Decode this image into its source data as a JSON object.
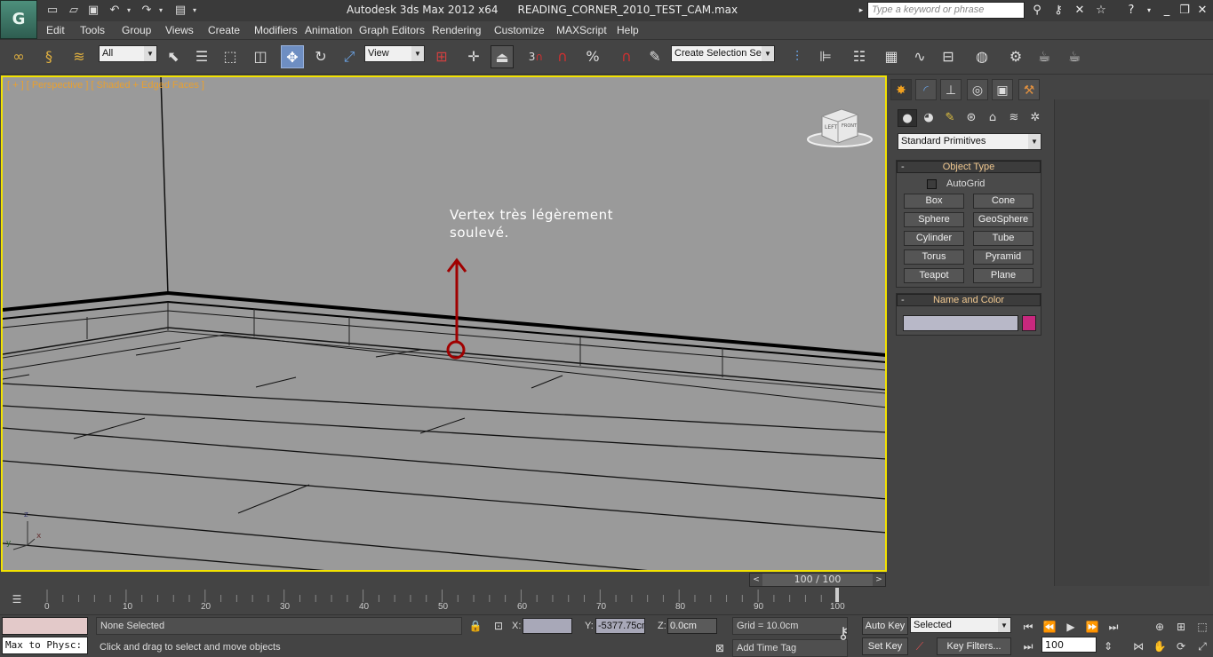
{
  "app": {
    "logo": "G",
    "title_app": "Autodesk 3ds Max  2012 x64",
    "title_file": "READING_CORNER_2010_TEST_CAM.max",
    "search_placeholder": "Type a keyword or phrase"
  },
  "menu": [
    "Edit",
    "Tools",
    "Group",
    "Views",
    "Create",
    "Modifiers",
    "Animation",
    "Graph Editors",
    "Rendering",
    "Customize",
    "MAXScript",
    "Help"
  ],
  "toolbar": {
    "selection_filter": "All",
    "ref_coord": "View",
    "named_selection": "Create Selection Se",
    "snap_label": "3"
  },
  "viewport": {
    "label": "[ + ] [ Perspective ] [ Shaded + Edged Faces ]",
    "annotation": "Vertex très légèrement\nsoulevé.",
    "viewcube_left": "LEFT",
    "viewcube_front": "FRONT",
    "axis_x": "x",
    "axis_y": "y",
    "axis_z": "z",
    "annotation_color": "#a00000",
    "border_color": "#f3e300"
  },
  "command_panel": {
    "category": "Standard Primitives",
    "object_type_title": "Object Type",
    "autogrid_label": "AutoGrid",
    "buttons": [
      "Box",
      "Cone",
      "Sphere",
      "GeoSphere",
      "Cylinder",
      "Tube",
      "Torus",
      "Pyramid",
      "Teapot",
      "Plane"
    ],
    "name_color_title": "Name and Color",
    "object_name": "",
    "object_color": "#c8287e",
    "minus": "-"
  },
  "timeline": {
    "frame_display": "100 / 100",
    "ticks": [
      "0",
      "10",
      "20",
      "30",
      "40",
      "50",
      "60",
      "70",
      "80",
      "90",
      "100"
    ],
    "current_frame": 100,
    "total_frames": 100
  },
  "status": {
    "maxscript_listener": "Max to Physc:",
    "selection_info": "None Selected",
    "prompt": "Click and drag to select and move objects",
    "x_label": "X:",
    "x_value": "",
    "y_label": "Y:",
    "y_value": "-5377.75cm",
    "z_label": "Z:",
    "z_value": "0.0cm",
    "grid": "Grid = 10.0cm",
    "add_time_tag": "Add Time Tag",
    "auto_key": "Auto Key",
    "set_key": "Set Key",
    "key_mode": "Selected",
    "key_filters": "Key Filters...",
    "frame_value": "100"
  }
}
